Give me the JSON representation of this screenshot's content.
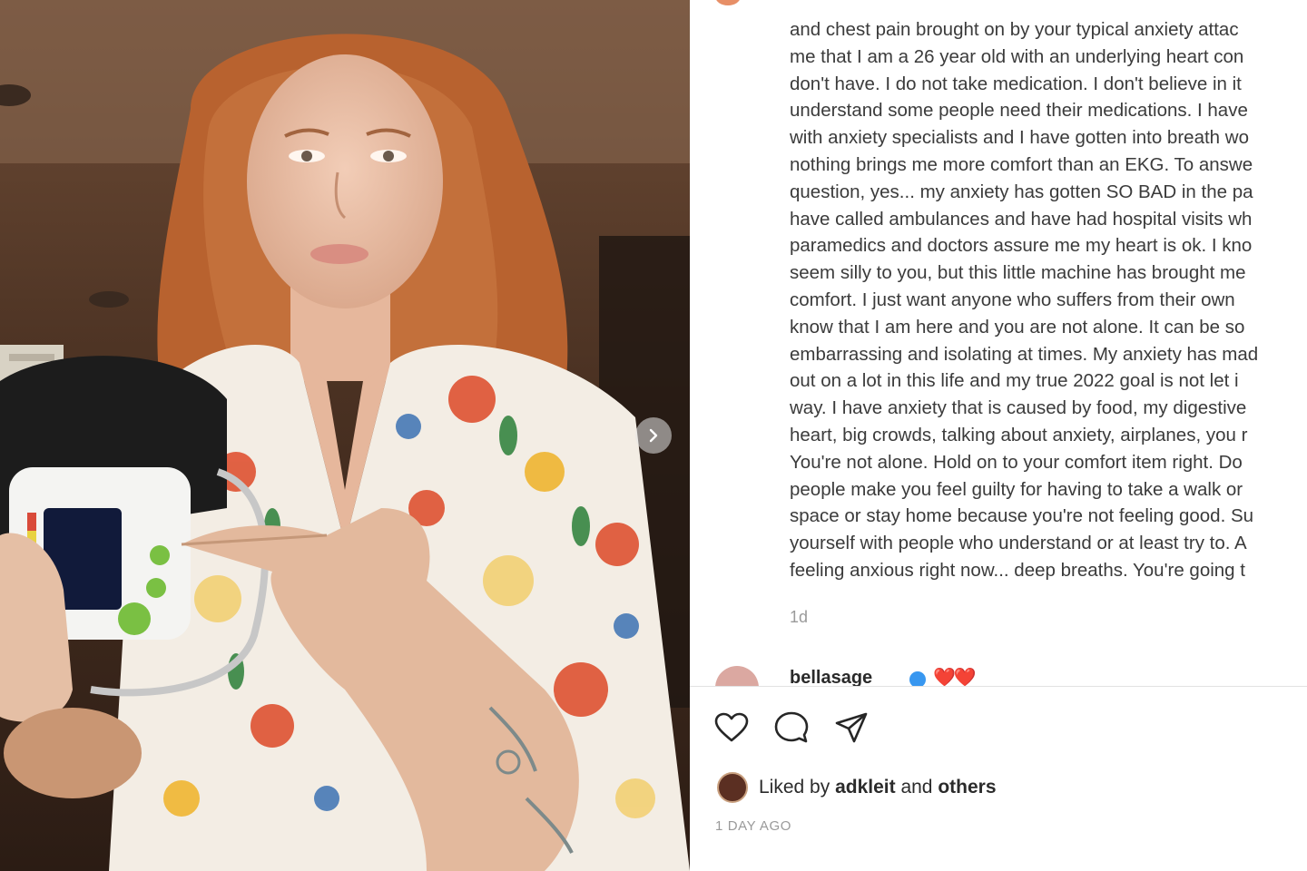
{
  "post": {
    "caption_lines": [
      "and chest pain brought on by your typical anxiety attac",
      "me that I am a 26 year old with an underlying heart con",
      "don't have. I do not take medication. I don't believe in it",
      "understand some people need their medications. I have",
      "with anxiety specialists and I have gotten into breath wo",
      "nothing brings me more comfort than an EKG. To answe",
      "question, yes... my anxiety has gotten SO BAD in the pa",
      "have called ambulances and have had hospital visits wh",
      "paramedics and doctors assure me my heart is ok. I kno",
      "seem silly to you, but this little machine has brought me",
      "comfort. I just want anyone who suffers from their own",
      "know that I am here and you are not alone. It can be so",
      "embarrassing and isolating at times. My anxiety has mad",
      "out on a lot in this life and my true 2022 goal is not let i",
      "way. I have anxiety that is caused by food, my digestive",
      "heart, big crowds, talking about anxiety, airplanes, you r",
      "You're not alone. Hold on to your comfort item right. Do",
      "people make you feel guilty for having to take a walk or",
      "space or stay home because you're not feeling good. Su",
      "yourself with people who understand or at least try to. A",
      "feeling anxious right now... deep breaths. You're going t"
    ],
    "age": "1d"
  },
  "comment": {
    "username": "bellasage",
    "text": "❤️❤️"
  },
  "likes": {
    "prefix": "Liked by",
    "user": "adkleit",
    "and": "and",
    "others": "others"
  },
  "timestamp": "1 DAY AGO",
  "icons": {
    "like": "heart-icon",
    "comment": "comment-icon",
    "share": "share-icon",
    "next": "chevron-right-icon"
  },
  "colors": {
    "heart_red": "#d8242f",
    "verified_blue": "#3897f0",
    "muted_text": "#9a9a9a"
  }
}
